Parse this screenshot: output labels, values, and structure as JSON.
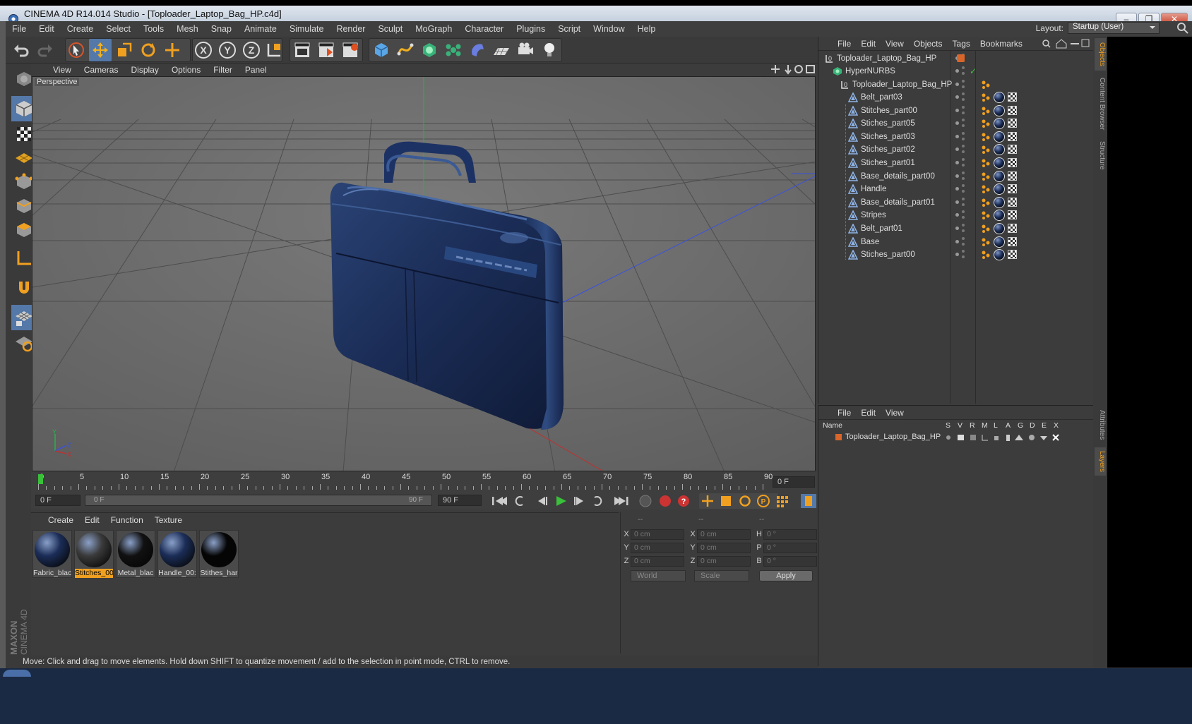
{
  "window": {
    "title": "CINEMA 4D R14.014 Studio - [Toploader_Laptop_Bag_HP.c4d]"
  },
  "menu": [
    "File",
    "Edit",
    "Create",
    "Select",
    "Tools",
    "Mesh",
    "Snap",
    "Animate",
    "Simulate",
    "Render",
    "Sculpt",
    "MoGraph",
    "Character",
    "Plugins",
    "Script",
    "Window",
    "Help"
  ],
  "layout": {
    "label": "Layout:",
    "value": "Startup (User)"
  },
  "viewport": {
    "menu": [
      "View",
      "Cameras",
      "Display",
      "Options",
      "Filter",
      "Panel"
    ],
    "label": "Perspective"
  },
  "timeline": {
    "ticks": [
      "0",
      "5",
      "10",
      "15",
      "20",
      "25",
      "30",
      "35",
      "40",
      "45",
      "50",
      "55",
      "60",
      "65",
      "70",
      "75",
      "80",
      "85",
      "90"
    ],
    "end_field": "0 F",
    "current": "0 F",
    "range_start": "0 F",
    "range_end": "90 F",
    "max": "90 F"
  },
  "materials": {
    "menu": [
      "Create",
      "Edit",
      "Function",
      "Texture"
    ],
    "items": [
      {
        "label": "Fabric_blac",
        "color": "#1b2d57"
      },
      {
        "label": "Stitches_00",
        "color": "#3a3a3a"
      },
      {
        "label": "Metal_blac",
        "color": "#111111"
      },
      {
        "label": "Handle_00:",
        "color": "#1b2d57"
      },
      {
        "label": "Stithes_har",
        "color": "#050505"
      }
    ]
  },
  "coords": {
    "headers": [
      "--",
      "--",
      "--"
    ],
    "rows": [
      {
        "a": "X",
        "av": "0 cm",
        "b": "X",
        "bv": "0 cm",
        "c": "H",
        "cv": "0 °"
      },
      {
        "a": "Y",
        "av": "0 cm",
        "b": "Y",
        "bv": "0 cm",
        "c": "P",
        "cv": "0 °"
      },
      {
        "a": "Z",
        "av": "0 cm",
        "b": "Z",
        "bv": "0 cm",
        "c": "B",
        "cv": "0 °"
      }
    ],
    "world": "World",
    "scale": "Scale",
    "apply": "Apply"
  },
  "status": "Move: Click and drag to move elements. Hold down SHIFT to quantize movement / add to the selection in point mode, CTRL to remove.",
  "objects": {
    "menu": [
      "File",
      "Edit",
      "View",
      "Objects",
      "Tags",
      "Bookmarks"
    ],
    "root": "Toploader_Laptop_Bag_HP",
    "hypernurbs": "HyperNURBS",
    "group": "Toploader_Laptop_Bag_HP",
    "children": [
      "Belt_part03",
      "Stitches_part00",
      "Stiches_part05",
      "Stiches_part03",
      "Stiches_part02",
      "Stiches_part01",
      "Base_details_part00",
      "Handle",
      "Base_details_part01",
      "Stripes",
      "Belt_part01",
      "Base",
      "Stiches_part00"
    ]
  },
  "layers": {
    "menu": [
      "File",
      "Edit",
      "View"
    ],
    "columns": [
      "Name",
      "S",
      "V",
      "R",
      "M",
      "L",
      "A",
      "G",
      "D",
      "E",
      "X"
    ],
    "row": "Toploader_Laptop_Bag_HP"
  },
  "side_tabs": [
    "Objects",
    "Content Browser",
    "Structure",
    "Attributes",
    "Layers"
  ],
  "brand": {
    "maxon": "MAXON",
    "product": "CINEMA 4D"
  },
  "colors": {
    "accent": "#5478a8",
    "selection": "#f0a020",
    "bag": "#1b2d57"
  }
}
